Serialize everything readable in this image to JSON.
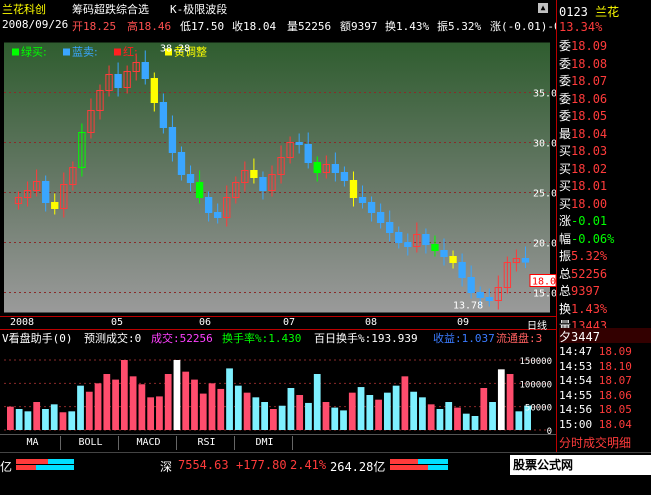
{
  "title": {
    "stock_name": "兰花科创",
    "indicator": "筹码超跌综合选",
    "indicator2": "K-极限波段"
  },
  "info": {
    "date": "2008/09/26",
    "open": "开18.25",
    "high": "高18.46",
    "low": "低17.50",
    "close": "收18.04",
    "volume": "量52256",
    "amount": "额9397",
    "turnover": "换1.43%",
    "amplitude": "振5.32%",
    "change": "涨(-0.01)-0"
  },
  "legend": {
    "green": "绿买:",
    "blue": "蓝卖:",
    "red": "红:",
    "yellow": "黄调整",
    "high_label": "38.28",
    "low_label": "13.78",
    "last_price": "18.04"
  },
  "y_axis": [
    "35.00",
    "30.00",
    "25.00",
    "20.00",
    "15.00"
  ],
  "x_axis": [
    "2008",
    "05",
    "06",
    "07",
    "08",
    "09",
    "日线"
  ],
  "volume_info": {
    "label": "V看盘助手(0)",
    "forecast": "预测成交:0",
    "volume": "成交:52256",
    "turnover": "换手率%:1.430",
    "hundred_day": "百日换手%:193.939",
    "income": "收益:1.037",
    "float": "流通盘:3"
  },
  "vol_axis": [
    "150000",
    "100000",
    "50000",
    "0"
  ],
  "tabs": [
    "MA",
    "BOLL",
    "MACD",
    "RSI",
    "DMI"
  ],
  "status": {
    "left_unit": "亿",
    "market": "深",
    "index": "7554.63",
    "delta": "+177.80",
    "pct": "2.41%",
    "amount": "264.28亿"
  },
  "right_panel": {
    "code": "0123",
    "name": "兰花",
    "pct_top": "13.34%",
    "rows": [
      {
        "label": "委",
        "value": "18.09"
      },
      {
        "label": "委",
        "value": "18.08"
      },
      {
        "label": "委",
        "value": "18.07"
      },
      {
        "label": "委",
        "value": "18.06"
      },
      {
        "label": "委",
        "value": "18.05"
      },
      {
        "label": "最",
        "value": "18.04"
      },
      {
        "label": "买",
        "value": "18.03"
      },
      {
        "label": "买",
        "value": "18.02"
      },
      {
        "label": "买",
        "value": "18.01"
      },
      {
        "label": "买",
        "value": "18.00"
      },
      {
        "label": "涨",
        "value": "-0.01"
      },
      {
        "label": "幅",
        "value": "-0.06%"
      },
      {
        "label": "振",
        "value": "5.32%"
      },
      {
        "label": "总",
        "value": "52256"
      },
      {
        "label": "总",
        "value": "9397"
      },
      {
        "label": "换",
        "value": "1.43%"
      },
      {
        "label": "量",
        "value": "13443"
      }
    ],
    "trade_code": "3447",
    "trades": [
      {
        "time": "14:47",
        "price": "18.09"
      },
      {
        "time": "14:53",
        "price": "18.10"
      },
      {
        "time": "14:54",
        "price": "18.07"
      },
      {
        "time": "14:55",
        "price": "18.06"
      },
      {
        "time": "14:56",
        "price": "18.05"
      },
      {
        "time": "15:00",
        "price": "18.04"
      }
    ],
    "footer": "分时成交明细"
  },
  "ad": "股票公式网 www.88gg.com",
  "colors": {
    "up": "#ff3b3b",
    "down": "#00ffff",
    "blue": "#3aa6ff",
    "yellow": "#ffff00",
    "green": "#00ff00"
  },
  "chart_data": [
    {
      "type": "candlestick",
      "y_ticks": [
        "35.00",
        "30.00",
        "25.00",
        "20.00",
        "15.00"
      ],
      "ylim": [
        13,
        40
      ],
      "x_ticks": [
        "2008",
        "05",
        "06",
        "07",
        "08",
        "09"
      ],
      "series": [
        {
          "name": "close",
          "values": [
            24.5,
            25.2,
            26.1,
            24.0,
            23.4,
            25.8,
            27.5,
            31.0,
            33.2,
            35.2,
            36.8,
            35.5,
            37.1,
            38.0,
            36.4,
            34.0,
            31.5,
            29.0,
            26.8,
            26.0,
            24.5,
            23.0,
            22.5,
            24.5,
            26.0,
            27.2,
            26.5,
            25.2,
            26.8,
            28.5,
            30.0,
            29.8,
            28.0,
            27.0,
            27.8,
            27.0,
            26.2,
            24.5,
            24.0,
            23.0,
            22.0,
            21.0,
            20.0,
            19.6,
            20.8,
            19.8,
            19.2,
            18.6,
            18.0,
            16.5,
            15.0,
            14.5,
            14.2,
            15.5,
            18.0,
            18.4,
            18.04
          ]
        }
      ]
    },
    {
      "type": "bar",
      "y_ticks": [
        "150000",
        "100000",
        "50000",
        "0"
      ],
      "ylim": [
        0,
        180000
      ],
      "values": [
        50000,
        45000,
        40000,
        60000,
        45000,
        55000,
        38000,
        40000,
        95000,
        82000,
        100000,
        120000,
        108000,
        150000,
        115000,
        98000,
        70000,
        72000,
        120000,
        150000,
        125000,
        108000,
        78000,
        100000,
        88000,
        132000,
        95000,
        80000,
        70000,
        60000,
        45000,
        52000,
        90000,
        75000,
        58000,
        120000,
        60000,
        48000,
        42000,
        80000,
        92000,
        75000,
        65000,
        80000,
        95000,
        115000,
        82000,
        70000,
        55000,
        45000,
        60000,
        48000,
        35000,
        30000,
        90000,
        60000,
        130000,
        120000,
        40000,
        52256
      ]
    }
  ]
}
